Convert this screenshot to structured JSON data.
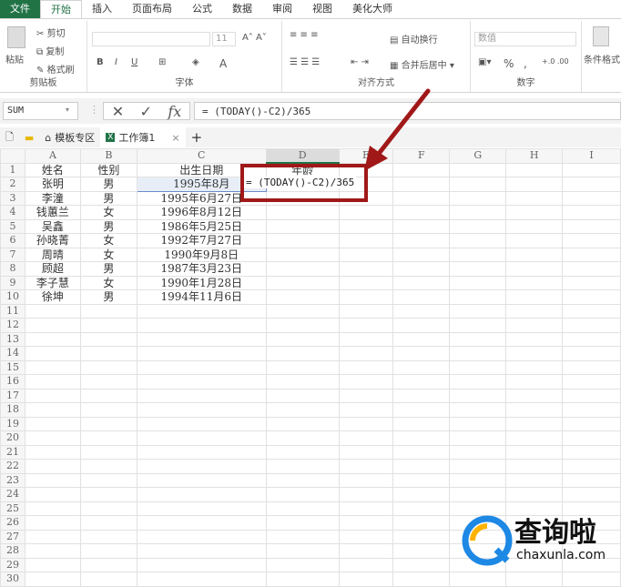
{
  "menu": {
    "tabs": [
      "文件",
      "开始",
      "插入",
      "页面布局",
      "公式",
      "数据",
      "审阅",
      "视图",
      "美化大师"
    ]
  },
  "ribbon": {
    "clipboard": {
      "paste": "粘贴",
      "cut": "剪切",
      "copy": "复制",
      "format_painter": "格式刷",
      "label": "剪贴板"
    },
    "font": {
      "size": "11",
      "bold": "B",
      "italic": "I",
      "underline": "U",
      "font_color": "A",
      "label": "字体"
    },
    "alignment": {
      "wrap": "自动换行",
      "merge": "合并后居中",
      "label": "对齐方式"
    },
    "number": {
      "format": "数值",
      "percent": "%",
      "comma": ",",
      "label": "数字"
    },
    "styles": {
      "conditional": "条件格式"
    }
  },
  "formula_bar": {
    "name_box": "SUM",
    "formula": "= (TODAY()-C2)/365"
  },
  "doc_tabs": {
    "template": "模板专区",
    "workbook": "工作簿1",
    "close": "×",
    "add": "+"
  },
  "columns": [
    "A",
    "B",
    "C",
    "D",
    "E",
    "F",
    "G",
    "H",
    "I"
  ],
  "rows": [
    [
      "姓名",
      "性别",
      "出生日期",
      "年龄"
    ],
    [
      "张明",
      "男",
      "1995年8月",
      ""
    ],
    [
      "李潼",
      "男",
      "1995年6月27日",
      ""
    ],
    [
      "钱蕙兰",
      "女",
      "1996年8月12日",
      ""
    ],
    [
      "吴鑫",
      "男",
      "1986年5月25日",
      ""
    ],
    [
      "孙晓菁",
      "女",
      "1992年7月27日",
      ""
    ],
    [
      "周晴",
      "女",
      "1990年9月8日",
      ""
    ],
    [
      "顾超",
      "男",
      "1987年3月23日",
      ""
    ],
    [
      "李子慧",
      "女",
      "1990年1月28日",
      ""
    ],
    [
      "徐坤",
      "男",
      "1994年11月6日",
      ""
    ]
  ],
  "row_count": 30,
  "cell_edit": "= (TODAY()-C2)/365",
  "watermark": {
    "name": "查询啦",
    "url": "chaxunla.com"
  },
  "colors": {
    "accent": "#217346",
    "annotation": "#a01818"
  }
}
